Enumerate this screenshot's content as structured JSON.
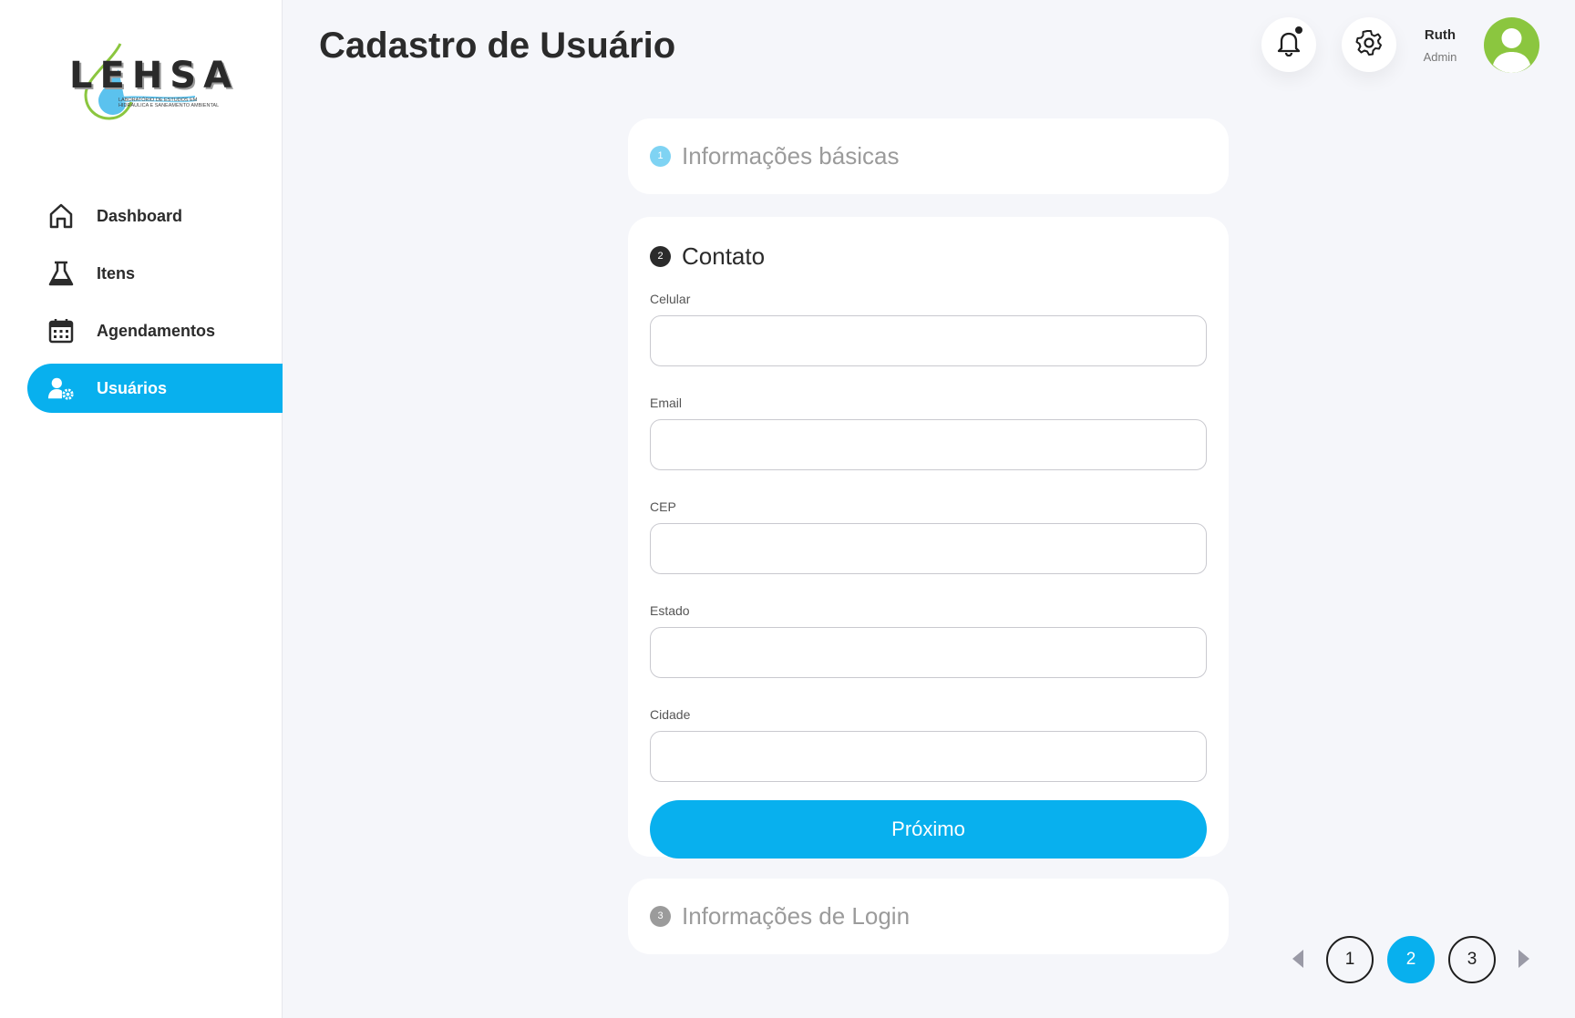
{
  "logo": {
    "name": "LEHSA",
    "subtitle": "Laboratório de Estudos em Hidráulica e Saneamento Ambiental"
  },
  "sidebar": {
    "items": [
      {
        "label": "Dashboard",
        "icon": "home-icon",
        "active": false
      },
      {
        "label": "Itens",
        "icon": "flask-icon",
        "active": false
      },
      {
        "label": "Agendamentos",
        "icon": "calendar-icon",
        "active": false
      },
      {
        "label": "Usuários",
        "icon": "user-gear-icon",
        "active": true
      }
    ]
  },
  "header": {
    "title": "Cadastro de Usuário",
    "user": {
      "name": "Ruth",
      "role": "Admin"
    }
  },
  "steps": [
    {
      "number": "1",
      "title": "Informações básicas",
      "state": "collapsed"
    },
    {
      "number": "2",
      "title": "Contato",
      "state": "expanded"
    },
    {
      "number": "3",
      "title": "Informações de Login",
      "state": "collapsed"
    }
  ],
  "form": {
    "fields": [
      {
        "label": "Celular",
        "value": ""
      },
      {
        "label": "Email",
        "value": ""
      },
      {
        "label": "CEP",
        "value": ""
      },
      {
        "label": "Estado",
        "value": ""
      },
      {
        "label": "Cidade",
        "value": ""
      }
    ],
    "next_label": "Próximo"
  },
  "pagination": {
    "pages": [
      "1",
      "2",
      "3"
    ],
    "current": "2"
  },
  "colors": {
    "accent": "#08b0ee",
    "avatar": "#8bc63f",
    "background": "#f5f6fa",
    "step1": "#7fd3f3",
    "step2": "#2b2b2b",
    "step3": "#9b9b9b"
  }
}
